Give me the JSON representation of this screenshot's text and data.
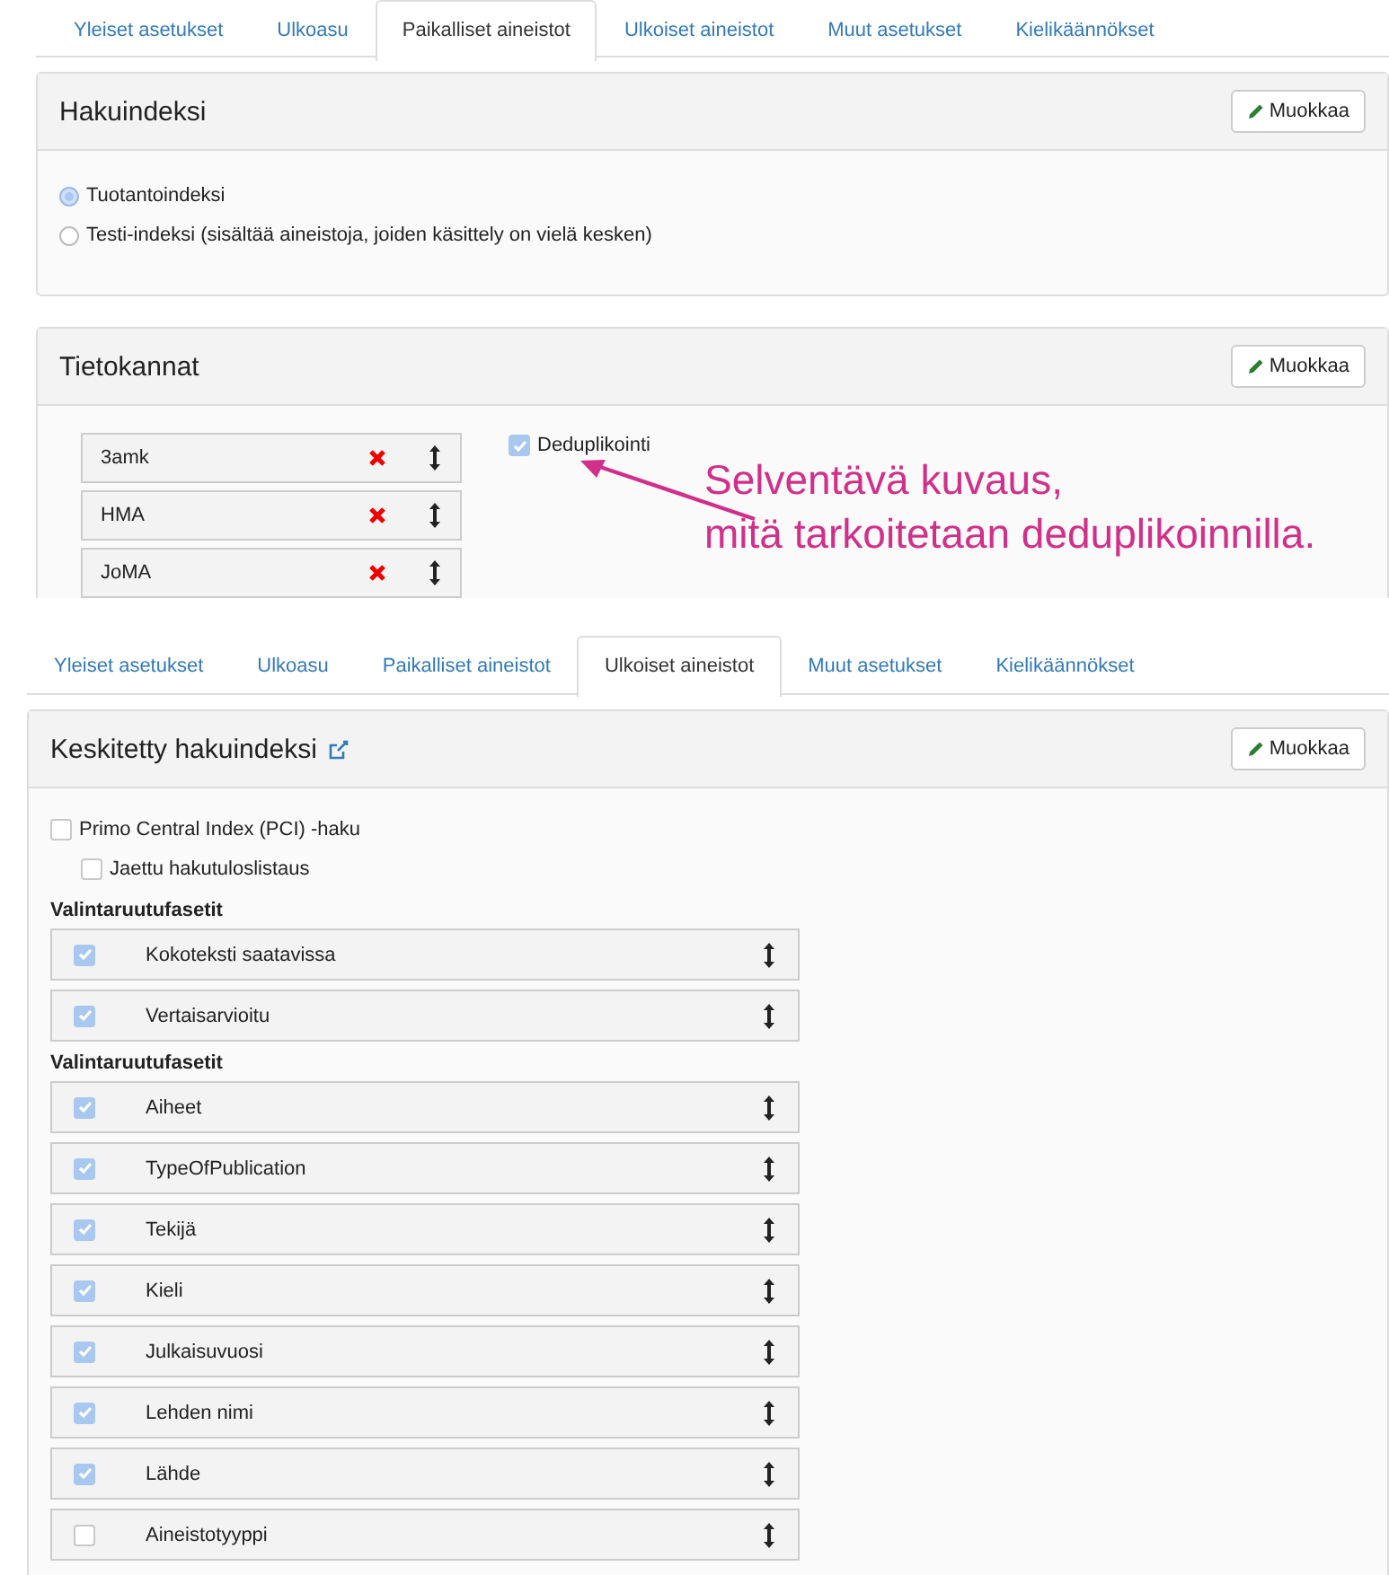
{
  "top_screen": {
    "tabs": [
      {
        "label": "Yleiset asetukset",
        "selected": false
      },
      {
        "label": "Ulkoasu",
        "selected": false
      },
      {
        "label": "Paikalliset aineistot",
        "selected": true
      },
      {
        "label": "Ulkoiset aineistot",
        "selected": false
      },
      {
        "label": "Muut asetukset",
        "selected": false
      },
      {
        "label": "Kielikäännökset",
        "selected": false
      }
    ],
    "search_index_panel": {
      "title": "Hakuindeksi",
      "edit_button": "Muokkaa",
      "radios": [
        {
          "label": "Tuotantoindeksi",
          "selected": true
        },
        {
          "label": "Testi-indeksi (sisältää aineistoja, joiden käsittely on vielä kesken)",
          "selected": false
        }
      ]
    },
    "databases_panel": {
      "title": "Tietokannat",
      "edit_button": "Muokkaa",
      "databases": [
        {
          "name": "3amk"
        },
        {
          "name": "HMA"
        },
        {
          "name": "JoMA"
        }
      ],
      "deduplication": {
        "label": "Deduplikointi",
        "checked": true
      }
    },
    "annotation": {
      "lines": [
        "Selventävä kuvaus,",
        "mitä tarkoitetaan deduplikoinnilla."
      ]
    }
  },
  "bottom_screen": {
    "tabs": [
      {
        "label": "Yleiset asetukset",
        "selected": false
      },
      {
        "label": "Ulkoasu",
        "selected": false
      },
      {
        "label": "Paikalliset aineistot",
        "selected": false
      },
      {
        "label": "Ulkoiset aineistot",
        "selected": true
      },
      {
        "label": "Muut asetukset",
        "selected": false
      },
      {
        "label": "Kielikäännökset",
        "selected": false
      }
    ],
    "central_index_panel": {
      "title": "Keskitetty hakuindeksi",
      "edit_button": "Muokkaa",
      "options": [
        {
          "label": "Primo Central Index (PCI) -haku",
          "checked": false,
          "children": [
            {
              "label": "Jaettu hakutuloslistaus",
              "checked": false
            }
          ]
        }
      ],
      "facet_groups": [
        {
          "heading": "Valintaruutufasetit",
          "items": [
            {
              "label": "Kokoteksti saatavissa",
              "checked": true
            },
            {
              "label": "Vertaisarvioitu",
              "checked": true
            }
          ]
        },
        {
          "heading": "Valintaruutufasetit",
          "items": [
            {
              "label": "Aiheet",
              "checked": true
            },
            {
              "label": "TypeOfPublication",
              "checked": true
            },
            {
              "label": "Tekijä",
              "checked": true
            },
            {
              "label": "Kieli",
              "checked": true
            },
            {
              "label": "Julkaisuvuosi",
              "checked": true
            },
            {
              "label": "Lehden nimi",
              "checked": true
            },
            {
              "label": "Lähde",
              "checked": true
            },
            {
              "label": "Aineistotyyppi",
              "checked": false
            }
          ]
        }
      ]
    }
  }
}
